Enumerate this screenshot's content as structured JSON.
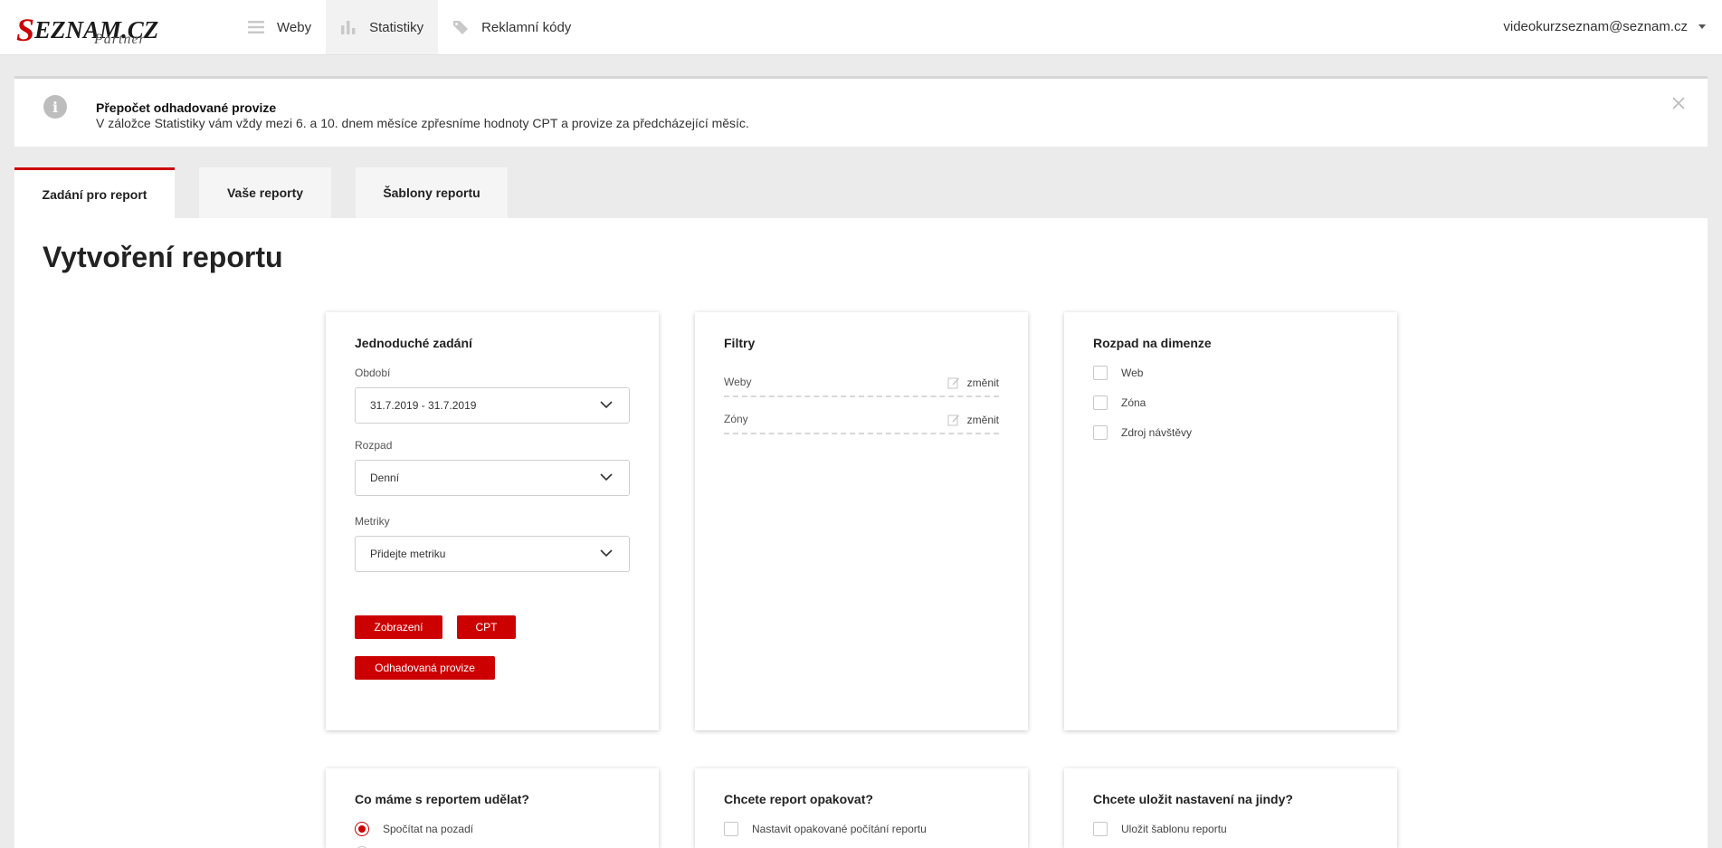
{
  "brand": {
    "name_first": "S",
    "name_rest": "EZNAM.CZ",
    "sub": "Partner"
  },
  "nav": {
    "items": [
      {
        "label": "Weby"
      },
      {
        "label": "Statistiky"
      },
      {
        "label": "Reklamní kódy"
      }
    ],
    "user_email": "videokurzseznam@seznam.cz"
  },
  "notice": {
    "title": "Přepočet odhadované provize",
    "text": "V záložce Statistiky vám vždy mezi 6. a 10. dnem měsíce zpřesníme hodnoty CPT a provize za předcházející měsíc."
  },
  "tabs": [
    {
      "label": "Zadání pro report",
      "active": true
    },
    {
      "label": "Vaše reporty",
      "active": false
    },
    {
      "label": "Šablony reportu",
      "active": false
    }
  ],
  "page_title": "Vytvoření reportu",
  "simple": {
    "title": "Jednoduché zadání",
    "period_label": "Období",
    "period_value": "31.7.2019 - 31.7.2019",
    "breakdown_label": "Rozpad",
    "breakdown_value": "Denní",
    "metrics_label": "Metriky",
    "metrics_placeholder": "Přidejte metriku",
    "selected_metrics": [
      "Zobrazení",
      "CPT",
      "Odhadovaná provize"
    ]
  },
  "filters": {
    "title": "Filtry",
    "rows": [
      {
        "label": "Weby",
        "action": "změnit"
      },
      {
        "label": "Zóny",
        "action": "změnit"
      }
    ]
  },
  "dimensions": {
    "title": "Rozpad na dimenze",
    "items": [
      {
        "label": "Web",
        "checked": false
      },
      {
        "label": "Zóna",
        "checked": false
      },
      {
        "label": "Zdroj návštěvy",
        "checked": false
      }
    ]
  },
  "action": {
    "title": "Co máme s reportem udělat?",
    "options": [
      {
        "label": "Spočítat na pozadí",
        "selected": true
      }
    ]
  },
  "repeat": {
    "title": "Chcete report opakovat?",
    "option": "Nastavit opakované počítání reportu"
  },
  "save": {
    "title": "Chcete uložit nastavení na jindy?",
    "option": "Uložit šablonu reportu"
  },
  "colors": {
    "accent": "#cc0000",
    "background": "#ebebeb"
  }
}
